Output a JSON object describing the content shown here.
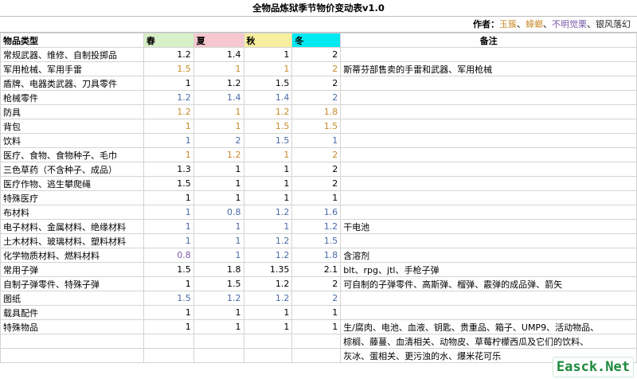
{
  "title": "全物品炼狱季节物价变动表v1.0",
  "authors": {
    "label": "作者：",
    "names": [
      "玉簇",
      "蟑螂",
      "不明觉栗",
      "银风落幻"
    ],
    "separator": "、"
  },
  "headers": {
    "type": "物品类型",
    "spring": "春",
    "summer": "夏",
    "autumn": "秋",
    "winter": "冬",
    "note": "备注"
  },
  "rows": [
    {
      "name": "常规武器、维修、自制投掷品",
      "v": [
        "1.2",
        "1.4",
        "1",
        "2"
      ],
      "c": [
        "",
        "",
        "",
        ""
      ],
      "note": ""
    },
    {
      "name": "军用枪械、军用手雷",
      "v": [
        "1.5",
        "1",
        "1",
        "2"
      ],
      "c": [
        "orange",
        "orange",
        "orange",
        "orange"
      ],
      "note": "斯蒂芬部售卖的手雷和武器、军用枪械"
    },
    {
      "name": "盾牌、电器类武器、刀具零件",
      "v": [
        "1",
        "1.2",
        "1.5",
        "2"
      ],
      "c": [
        "",
        "",
        "",
        ""
      ],
      "note": ""
    },
    {
      "name": "枪械零件",
      "v": [
        "1.2",
        "1.4",
        "1.4",
        "2"
      ],
      "c": [
        "blue",
        "blue",
        "blue",
        "blue"
      ],
      "note": ""
    },
    {
      "name": "防具",
      "v": [
        "1.2",
        "1",
        "1.2",
        "1.8"
      ],
      "c": [
        "orange",
        "orange",
        "orange",
        "orange"
      ],
      "note": ""
    },
    {
      "name": "背包",
      "v": [
        "1",
        "1",
        "1.5",
        "1.5"
      ],
      "c": [
        "orange",
        "orange",
        "orange",
        "orange"
      ],
      "note": ""
    },
    {
      "name": "饮料",
      "v": [
        "1",
        "2",
        "1.5",
        "1"
      ],
      "c": [
        "blue",
        "blue",
        "blue",
        "blue"
      ],
      "note": ""
    },
    {
      "name": "医疗、食物、食物种子、毛巾",
      "v": [
        "1",
        "1.2",
        "1",
        "2"
      ],
      "c": [
        "orange",
        "orange",
        "orange",
        "orange"
      ],
      "note": ""
    },
    {
      "name": "三色草药（不含种子、成品）",
      "v": [
        "1.3",
        "1",
        "1",
        "2"
      ],
      "c": [
        "",
        "",
        "",
        ""
      ],
      "note": ""
    },
    {
      "name": "医疗作物、逃生攀爬绳",
      "v": [
        "1.5",
        "1",
        "1",
        "2"
      ],
      "c": [
        "",
        "",
        "",
        ""
      ],
      "note": ""
    },
    {
      "name": "特殊医疗",
      "v": [
        "1",
        "1",
        "1",
        "1"
      ],
      "c": [
        "",
        "",
        "",
        ""
      ],
      "note": ""
    },
    {
      "name": "布材料",
      "v": [
        "1",
        "0.8",
        "1.2",
        "1.6"
      ],
      "c": [
        "blue",
        "blue",
        "blue",
        "blue"
      ],
      "note": ""
    },
    {
      "name": "电子材料、金属材料、绝缘材料",
      "v": [
        "1",
        "1",
        "1",
        "1.2"
      ],
      "c": [
        "blue",
        "blue",
        "blue",
        "blue"
      ],
      "note": "干电池"
    },
    {
      "name": "土木材料、玻璃材料、塑料材料",
      "v": [
        "1",
        "1",
        "1.2",
        "1.5"
      ],
      "c": [
        "blue",
        "blue",
        "blue",
        "blue"
      ],
      "note": ""
    },
    {
      "name": "化学物质材料、燃料材料",
      "v": [
        "0.8",
        "1",
        "1.2",
        "1.8"
      ],
      "c": [
        "purple",
        "blue",
        "blue",
        "blue"
      ],
      "note": "含溶剂"
    },
    {
      "name": "常用子弹",
      "v": [
        "1.5",
        "1.8",
        "1.35",
        "2.1"
      ],
      "c": [
        "",
        "",
        "",
        ""
      ],
      "note": "blt、rpg、jtl、手枪子弹"
    },
    {
      "name": "自制子弹零件、特殊子弹",
      "v": [
        "1",
        "1.5",
        "1.2",
        "2"
      ],
      "c": [
        "",
        "",
        "",
        ""
      ],
      "note": "可自制的子弹零件、高斯弹、榴弹、霰弹的成品弹、箭矢"
    },
    {
      "name": "图纸",
      "v": [
        "1.5",
        "1.2",
        "1.2",
        "2"
      ],
      "c": [
        "blue",
        "blue",
        "blue",
        "blue"
      ],
      "note": ""
    },
    {
      "name": "载具配件",
      "v": [
        "1",
        "1",
        "1",
        "1"
      ],
      "c": [
        "",
        "",
        "",
        ""
      ],
      "note": ""
    },
    {
      "name": "特殊物品",
      "v": [
        "1",
        "1",
        "1",
        "1"
      ],
      "c": [
        "",
        "",
        "",
        ""
      ],
      "note": "生/腐肉、电池、血液、钥匙、贵重品、箱子、UMP9、活动物品、"
    }
  ],
  "note_extra": [
    "棕榈、藤蔓、血清相关、动物皮、草莓柠檬西瓜及它们的饮料、",
    "灰冰、蛋相关、更污浊的水、爆米花可乐"
  ],
  "watermark": "Easck.Net"
}
